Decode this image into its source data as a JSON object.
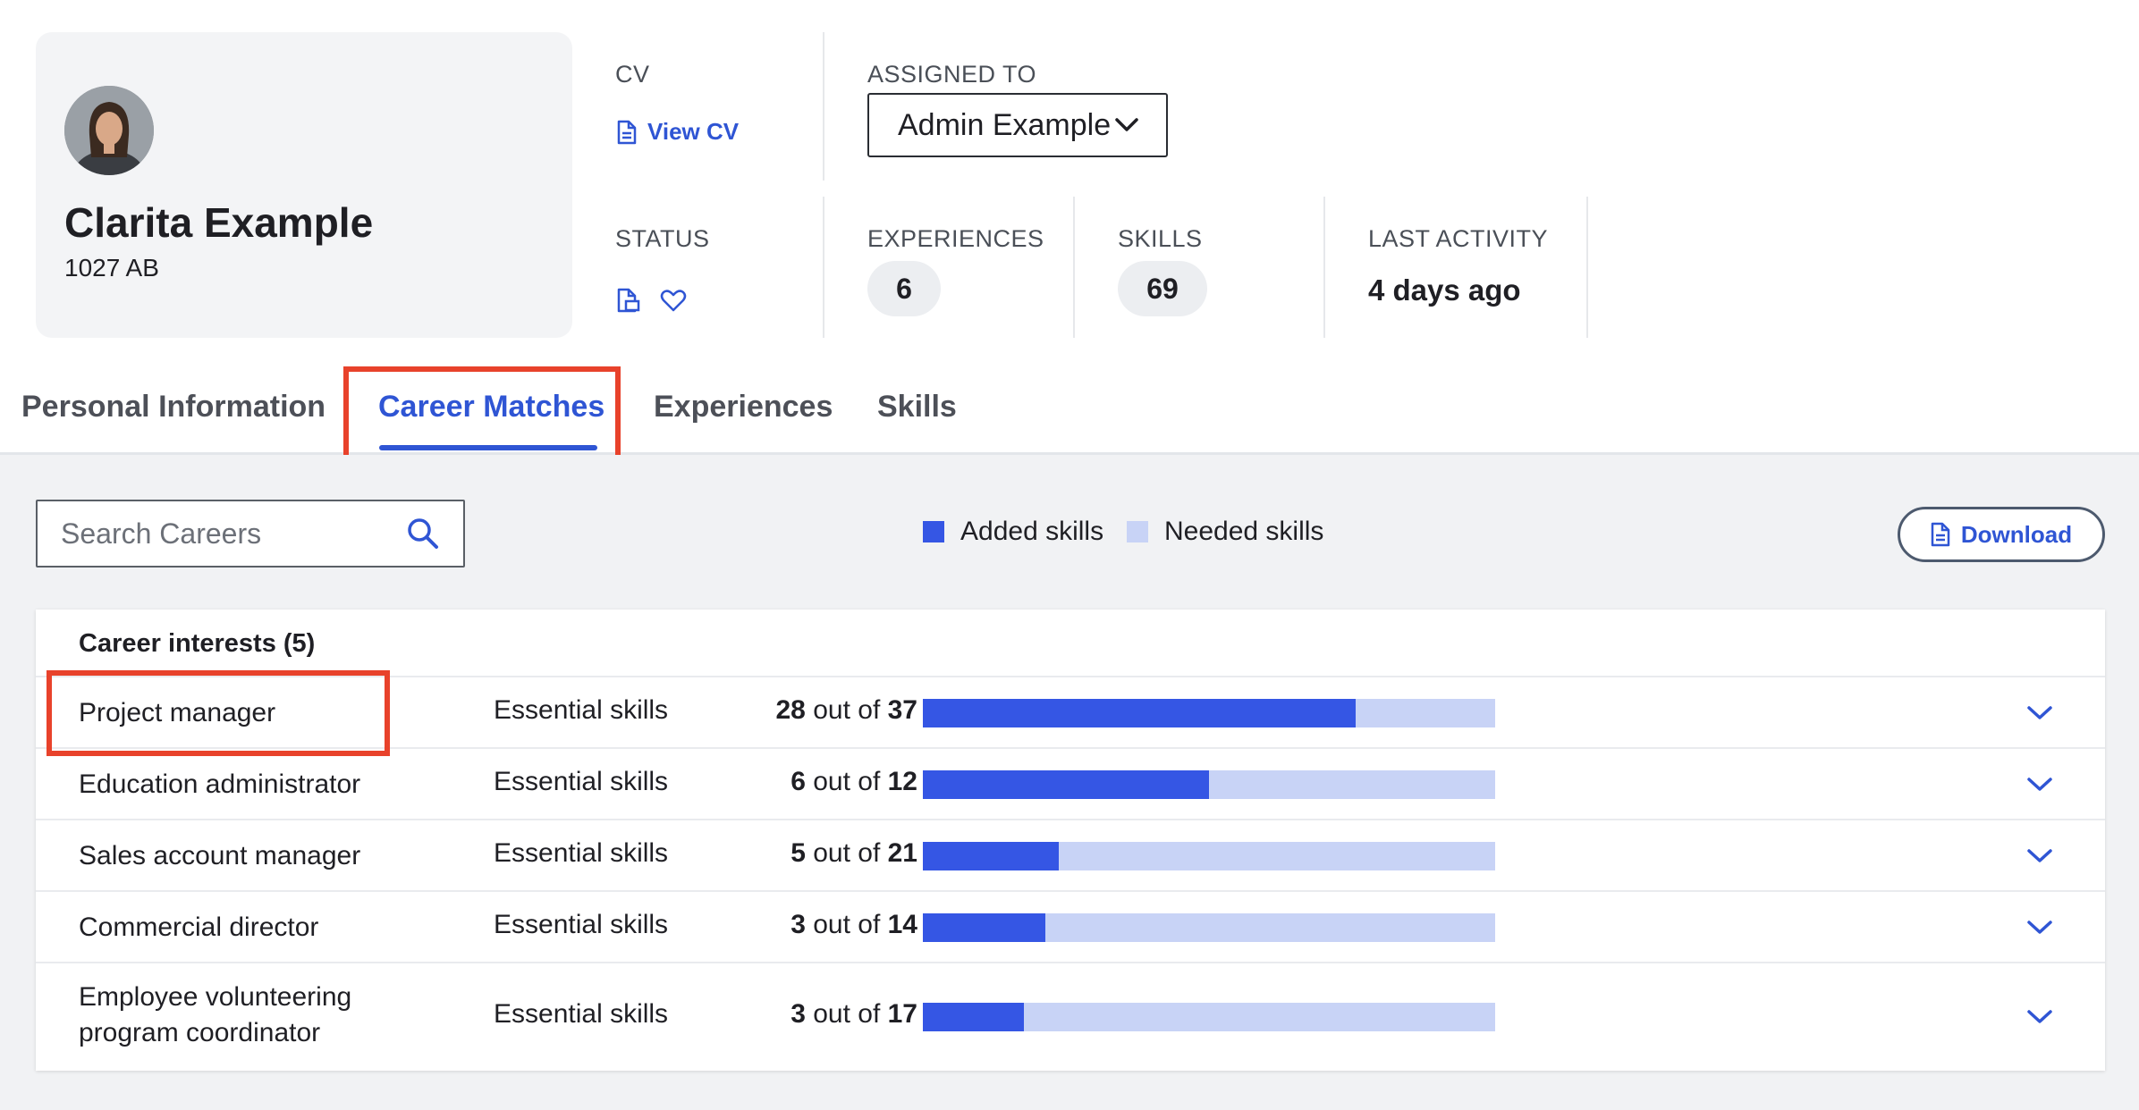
{
  "profile": {
    "name": "Clarita Example",
    "postcode": "1027 AB"
  },
  "cv": {
    "label": "CV",
    "link_label": "View CV"
  },
  "assigned": {
    "label": "ASSIGNED TO",
    "value": "Admin Example"
  },
  "status": {
    "label": "STATUS",
    "icons": [
      "document-icon",
      "heart-icon"
    ]
  },
  "experiences": {
    "label": "EXPERIENCES",
    "value": "6"
  },
  "skills": {
    "label": "SKILLS",
    "value": "69"
  },
  "last_activity": {
    "label": "LAST ACTIVITY",
    "value": "4 days ago"
  },
  "tabs": [
    {
      "label": "Personal Information",
      "active": false
    },
    {
      "label": "Career Matches",
      "active": true
    },
    {
      "label": "Experiences",
      "active": false
    },
    {
      "label": "Skills",
      "active": false
    }
  ],
  "search": {
    "placeholder": "Search Careers"
  },
  "legend": {
    "added": "Added skills",
    "needed": "Needed skills"
  },
  "download_label": "Download",
  "colors": {
    "accent": "#2f55d4",
    "added": "#3556e4",
    "needed": "#c8d3f6",
    "highlight": "#e8422b"
  },
  "career_interests": {
    "title": "Career interests (5)",
    "rows": [
      {
        "career": "Project manager",
        "type": "Essential skills",
        "added": "28",
        "total": "37",
        "fraction": 0.757
      },
      {
        "career": "Education administrator",
        "type": "Essential skills",
        "added": "6",
        "total": "12",
        "fraction": 0.5
      },
      {
        "career": "Sales account manager",
        "type": "Essential skills",
        "added": "5",
        "total": "21",
        "fraction": 0.238
      },
      {
        "career": "Commercial director",
        "type": "Essential skills",
        "added": "3",
        "total": "14",
        "fraction": 0.214
      },
      {
        "career": "Employee volunteering program coordinator",
        "type": "Essential skills",
        "added": "3",
        "total": "17",
        "fraction": 0.176
      }
    ],
    "out_of_text": "out of"
  }
}
